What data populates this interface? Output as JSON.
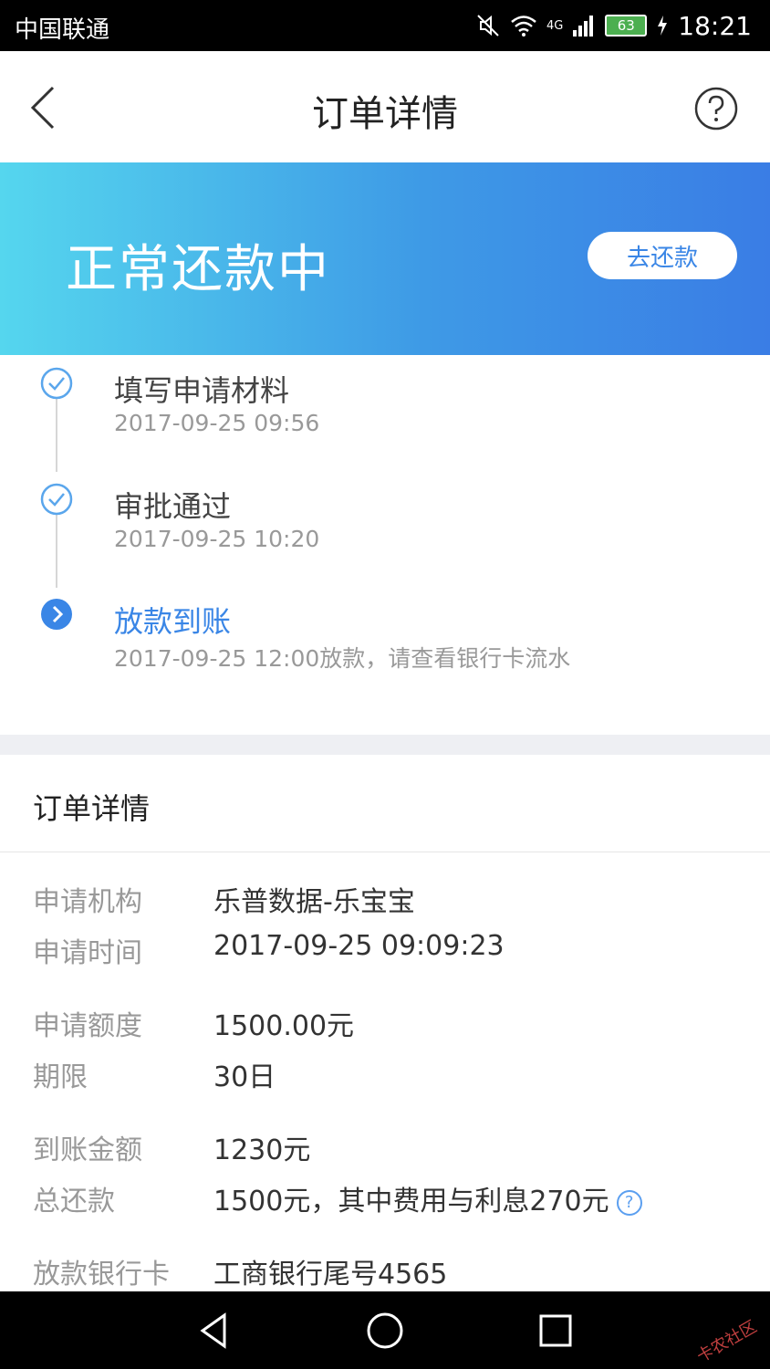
{
  "status_bar": {
    "carrier": "中国联通",
    "network": "4G",
    "battery": "63",
    "time": "18:21"
  },
  "nav": {
    "title": "订单详情",
    "back_icon": "chevron-left-icon",
    "help_icon": "question-circle-icon"
  },
  "banner": {
    "status": "正常还款中",
    "repay_button": "去还款"
  },
  "timeline": [
    {
      "title": "填写申请材料",
      "sub": "2017-09-25 09:56",
      "state": "done"
    },
    {
      "title": "审批通过",
      "sub": "2017-09-25 10:20",
      "state": "done"
    },
    {
      "title": "放款到账",
      "sub": "2017-09-25 12:00放款，请查看银行卡流水",
      "state": "current"
    }
  ],
  "details": {
    "header": "订单详情",
    "rows": [
      {
        "label": "申请机构",
        "value": "乐普数据-乐宝宝"
      },
      {
        "label": "申请时间",
        "value": "2017-09-25 09:09:23"
      },
      {
        "label": "申请额度",
        "value": "1500.00元"
      },
      {
        "label": "期限",
        "value": "30日"
      },
      {
        "label": "到账金额",
        "value": "1230元"
      },
      {
        "label": "总还款",
        "value": "1500元，其中费用与利息270元"
      },
      {
        "label": "放款银行卡",
        "value": "工商银行尾号4565"
      }
    ]
  },
  "watermark": "卡农社区",
  "colors": {
    "accent": "#3a86e6",
    "banner_start": "#55d6ee",
    "banner_end": "#3a7de5"
  }
}
